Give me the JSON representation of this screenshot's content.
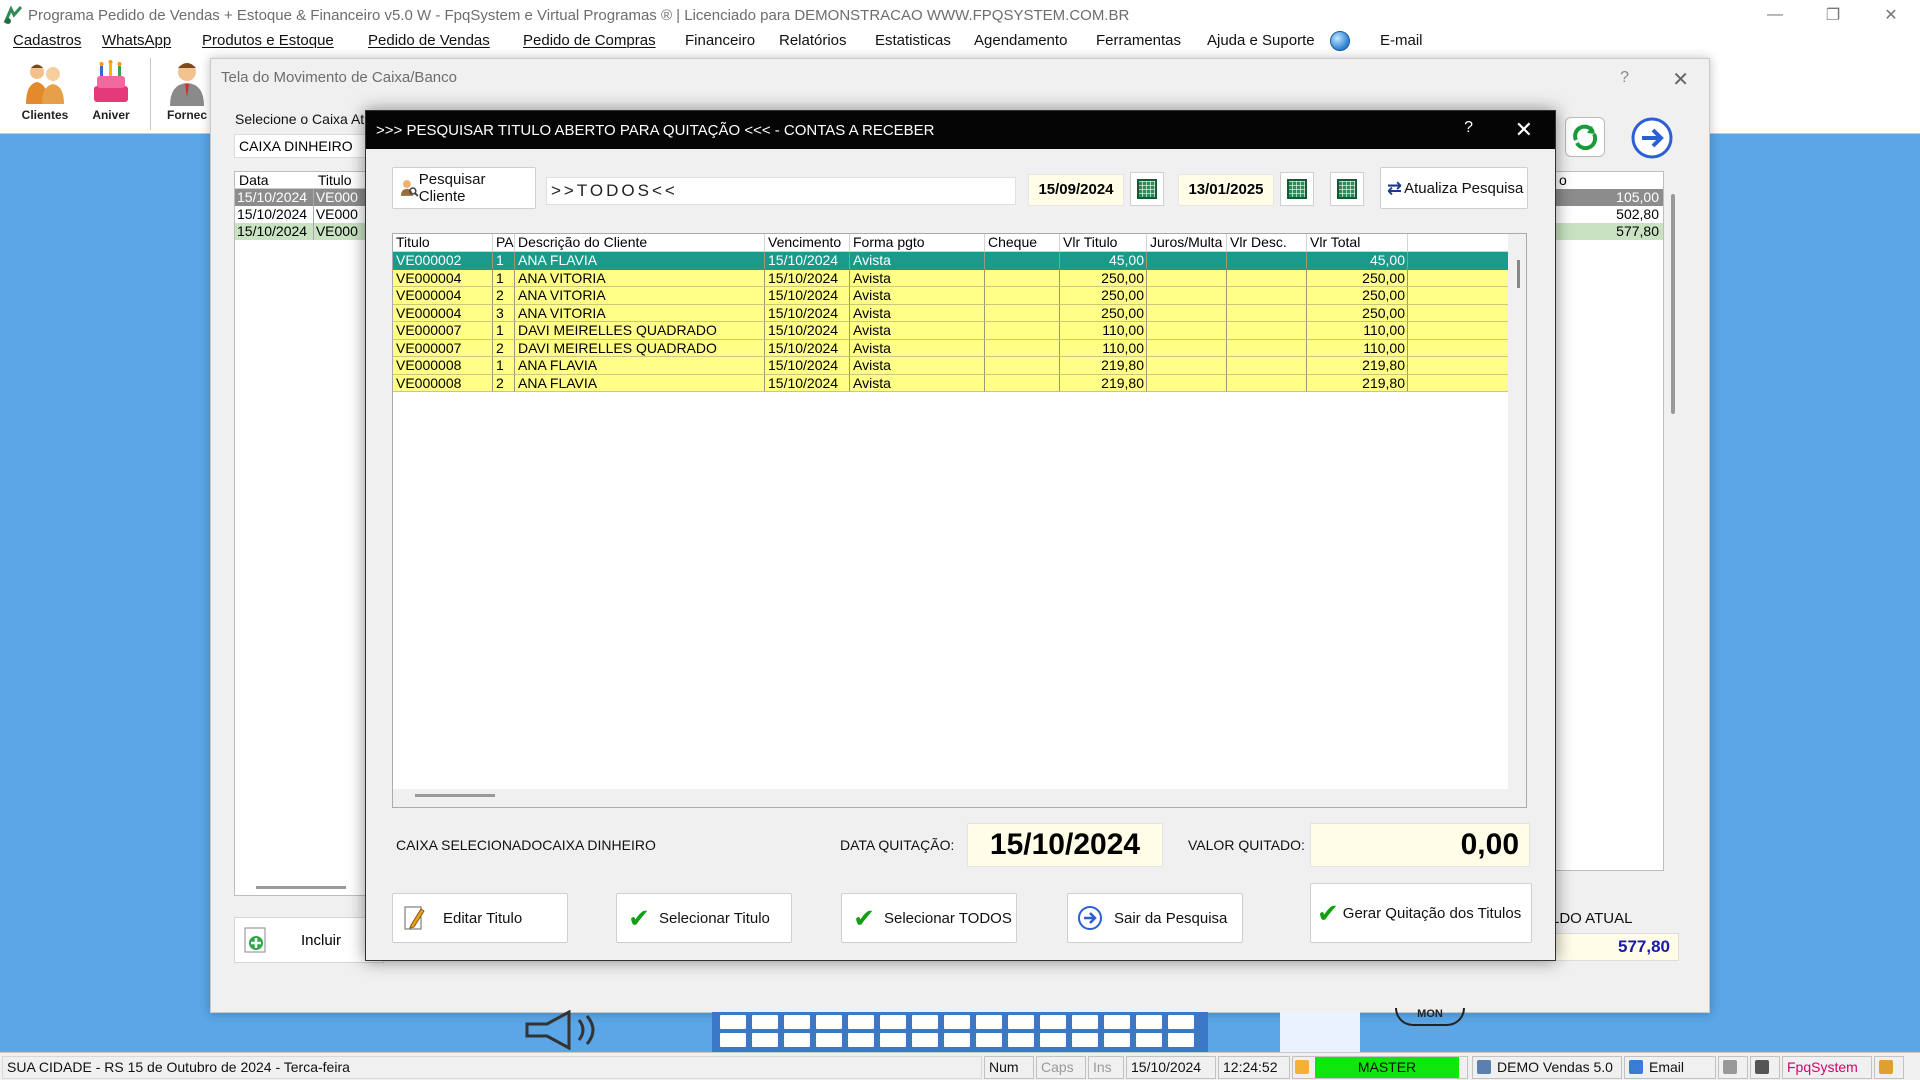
{
  "app": {
    "title": "Programa Pedido de Vendas + Estoque & Financeiro v5.0 W - FpqSystem e Virtual Programas ® | Licenciado para  DEMONSTRACAO WWW.FPQSYSTEM.COM.BR",
    "window_controls": [
      "—",
      "❐",
      "✕"
    ]
  },
  "menu": [
    {
      "label": "Cadastros"
    },
    {
      "label": "WhatsApp"
    },
    {
      "label": "Produtos e Estoque"
    },
    {
      "label": "Pedido de Vendas"
    },
    {
      "label": "Pedido de Compras"
    },
    {
      "label": "Financeiro"
    },
    {
      "label": "Relatórios"
    },
    {
      "label": "Estatisticas"
    },
    {
      "label": "Agendamento"
    },
    {
      "label": "Ferramentas"
    },
    {
      "label": "Ajuda e Suporte"
    },
    {
      "label": "E-mail"
    }
  ],
  "toolbar": {
    "clientes": "Clientes",
    "aniver": "Aniver",
    "fornec": "Fornec"
  },
  "caixa_window": {
    "title": "Tela do Movimento de Caixa/Banco",
    "select_label": "Selecione o Caixa Atu",
    "selected_caixa": "CAIXA DINHEIRO",
    "grid_headers": [
      "Data",
      "Titulo"
    ],
    "rows": [
      {
        "data": "15/10/2024",
        "titulo": "VE000"
      },
      {
        "data": "15/10/2024",
        "titulo": "VE000"
      },
      {
        "data": "15/10/2024",
        "titulo": "VE000"
      }
    ],
    "right_col_header": "o",
    "right_values": [
      "105,00",
      "502,80",
      "577,80"
    ],
    "incluir_label": "Incluir",
    "saldo_label": "LDO ATUAL",
    "saldo_value": "577,80"
  },
  "modal": {
    "title": ">>> PESQUISAR TITULO ABERTO PARA QUITAÇÃO <<< - CONTAS A RECEBER",
    "help": "?",
    "close": "✕",
    "pesquisar_cliente": "Pesquisar Cliente",
    "cliente_filter": ">>TODOS<<",
    "date_from": "15/09/2024",
    "date_to": "13/01/2025",
    "atualiza": "Atualiza Pesquisa",
    "columns": [
      "Titulo",
      "PA",
      "Descrição do Cliente",
      "Vencimento",
      "Forma pgto",
      "Cheque",
      "Vlr Titulo",
      "Juros/Multa",
      "Vlr Desc.",
      "Vlr Total"
    ],
    "rows": [
      {
        "titulo": "VE000002",
        "pa": "1",
        "cliente": "ANA FLAVIA",
        "venc": "15/10/2024",
        "forma": "Avista",
        "cheque": "",
        "vlr": "45,00",
        "juros": "",
        "desc": "",
        "total": "45,00"
      },
      {
        "titulo": "VE000004",
        "pa": "1",
        "cliente": "ANA VITORIA",
        "venc": "15/10/2024",
        "forma": "Avista",
        "cheque": "",
        "vlr": "250,00",
        "juros": "",
        "desc": "",
        "total": "250,00"
      },
      {
        "titulo": "VE000004",
        "pa": "2",
        "cliente": "ANA VITORIA",
        "venc": "15/10/2024",
        "forma": "Avista",
        "cheque": "",
        "vlr": "250,00",
        "juros": "",
        "desc": "",
        "total": "250,00"
      },
      {
        "titulo": "VE000004",
        "pa": "3",
        "cliente": "ANA VITORIA",
        "venc": "15/10/2024",
        "forma": "Avista",
        "cheque": "",
        "vlr": "250,00",
        "juros": "",
        "desc": "",
        "total": "250,00"
      },
      {
        "titulo": "VE000007",
        "pa": "1",
        "cliente": "DAVI MEIRELLES QUADRADO",
        "venc": "15/10/2024",
        "forma": "Avista",
        "cheque": "",
        "vlr": "110,00",
        "juros": "",
        "desc": "",
        "total": "110,00"
      },
      {
        "titulo": "VE000007",
        "pa": "2",
        "cliente": "DAVI MEIRELLES QUADRADO",
        "venc": "15/10/2024",
        "forma": "Avista",
        "cheque": "",
        "vlr": "110,00",
        "juros": "",
        "desc": "",
        "total": "110,00"
      },
      {
        "titulo": "VE000008",
        "pa": "1",
        "cliente": "ANA FLAVIA",
        "venc": "15/10/2024",
        "forma": "Avista",
        "cheque": "",
        "vlr": "219,80",
        "juros": "",
        "desc": "",
        "total": "219,80"
      },
      {
        "titulo": "VE000008",
        "pa": "2",
        "cliente": "ANA FLAVIA",
        "venc": "15/10/2024",
        "forma": "Avista",
        "cheque": "",
        "vlr": "219,80",
        "juros": "",
        "desc": "",
        "total": "219,80"
      }
    ],
    "caixa_selecionado": "CAIXA SELECIONADOCAIXA DINHEIRO",
    "data_quitacao_label": "DATA QUITAÇÃO:",
    "data_quitacao": "15/10/2024",
    "valor_quitado_label": "VALOR QUITADO:",
    "valor_quitado": "0,00",
    "buttons": {
      "editar": "Editar Titulo",
      "selecionar": "Selecionar Titulo",
      "selecionar_todos": "Selecionar TODOS",
      "sair": "Sair da Pesquisa",
      "gerar": "Gerar Quitação dos Titulos"
    }
  },
  "deco": {
    "mon": "MON"
  },
  "statusbar": {
    "city": "SUA CIDADE - RS 15 de Outubro de 2024 - Terca-feira",
    "num": "Num",
    "caps": "Caps",
    "ins": "Ins",
    "date": "15/10/2024",
    "time": "12:24:52",
    "user": "MASTER",
    "version": "DEMO Vendas 5.0",
    "email": "Email",
    "brand": "FpqSystem"
  },
  "colors": {
    "desktop": "#5aa6e6",
    "row_yellow": "#ffff87",
    "row_selected": "#1a9a8a",
    "field_yellow": "#fffde8",
    "master_green": "#0ee60e"
  }
}
